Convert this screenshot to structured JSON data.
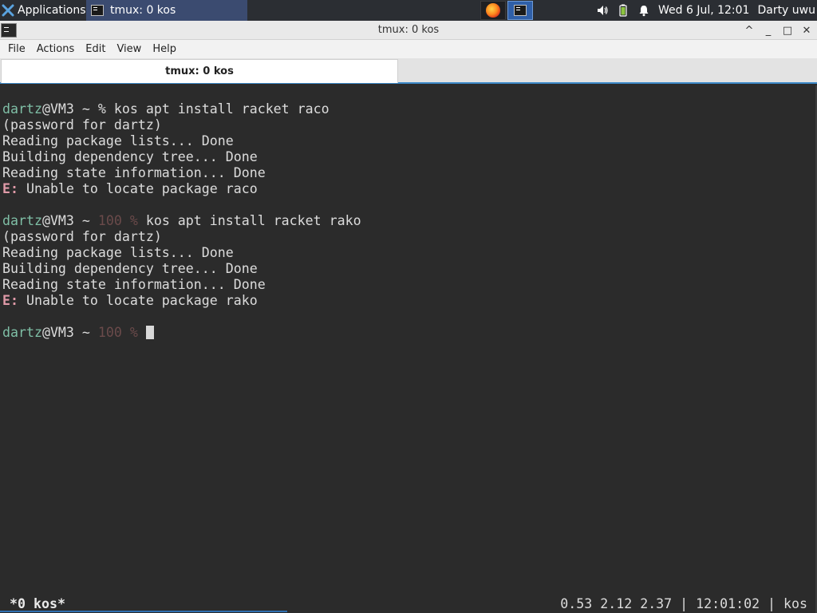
{
  "panel": {
    "applications_label": "Applications",
    "task_title": "tmux: 0 kos",
    "clock": "Wed  6 Jul, 12:01",
    "user": "Darty uwu"
  },
  "window": {
    "title": "tmux: 0 kos",
    "controls": {
      "shade": "^",
      "minimize": "_",
      "maximize": "□",
      "close": "✕"
    }
  },
  "menu": [
    "File",
    "Actions",
    "Edit",
    "View",
    "Help"
  ],
  "tab": {
    "label": "tmux: 0 kos"
  },
  "terminal": {
    "block1": {
      "prompt_user": "dartz",
      "prompt_host": "@VM3 ~ ",
      "prompt_sym": "% ",
      "command": "kos apt install racket raco",
      "password": "(password for dartz)",
      "reading": "Reading package lists... Done",
      "building": "Building dependency tree... Done",
      "state": "Reading state information... Done",
      "err_prefix": "E:",
      "err_msg": " Unable to locate package raco"
    },
    "block2": {
      "prompt_user": "dartz",
      "prompt_host": "@VM3 ~ ",
      "prompt_status": "100 % ",
      "command": "kos apt install racket rako",
      "password": "(password for dartz)",
      "reading": "Reading package lists... Done",
      "building": "Building dependency tree... Done",
      "state": "Reading state information... Done",
      "err_prefix": "E:",
      "err_msg": " Unable to locate package rako"
    },
    "prompt3": {
      "prompt_user": "dartz",
      "prompt_host": "@VM3 ~ ",
      "prompt_status": "100 % "
    }
  },
  "tmux_status": {
    "left": "*0 kos*",
    "right": "0.53 2.12 2.37 | 12:01:02 | kos"
  }
}
